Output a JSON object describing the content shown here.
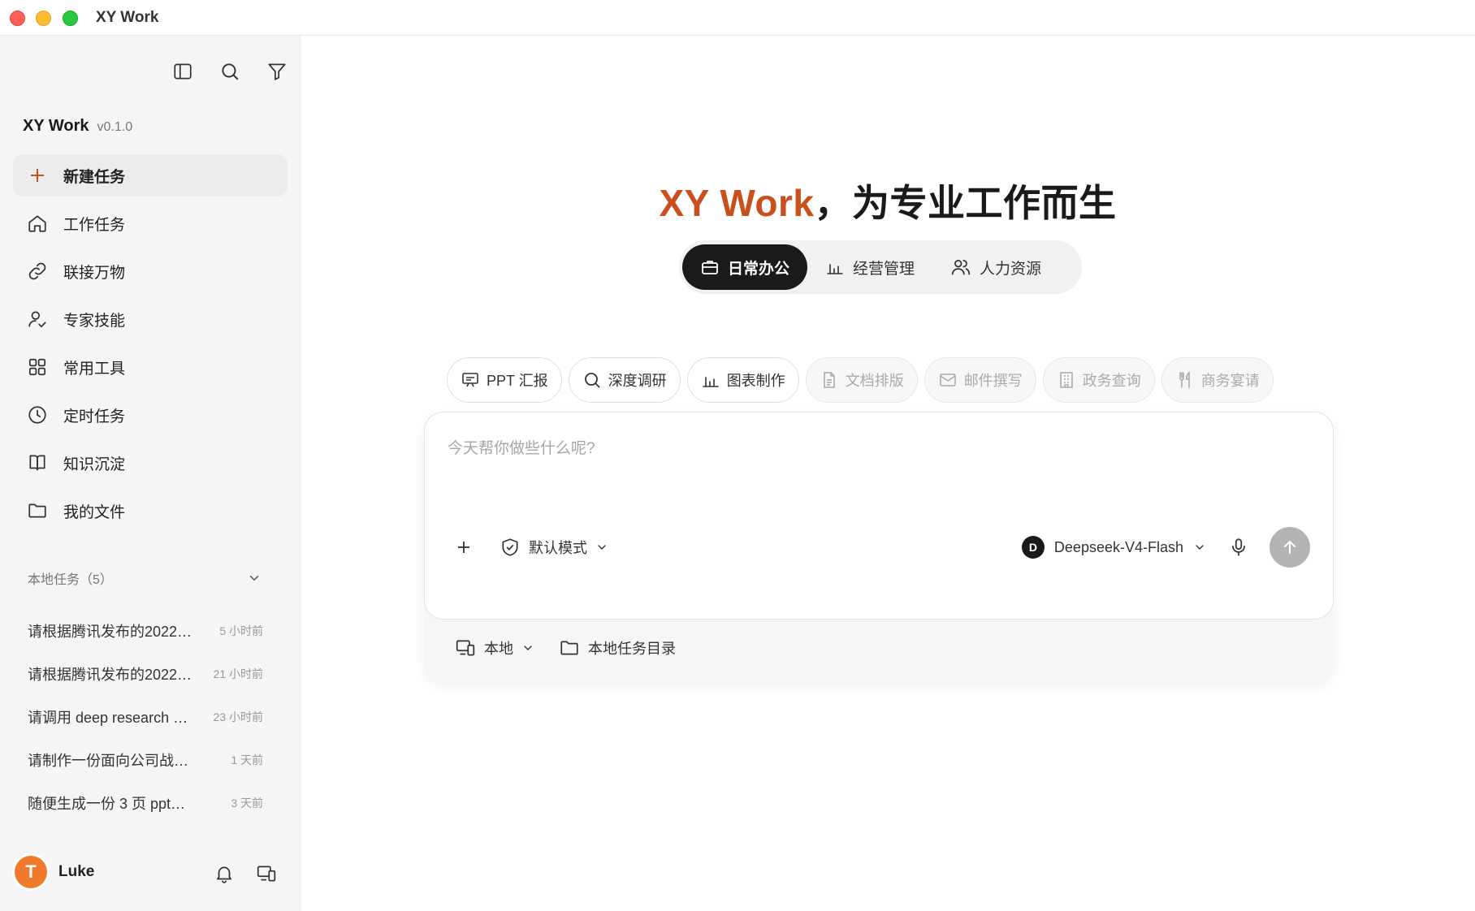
{
  "window": {
    "title": "XY Work"
  },
  "sidebar": {
    "brand": {
      "name": "XY Work",
      "version": "v0.1.0"
    },
    "nav": [
      {
        "label": "新建任务",
        "icon": "plus-icon"
      },
      {
        "label": "工作任务",
        "icon": "home-icon"
      },
      {
        "label": "联接万物",
        "icon": "link-icon"
      },
      {
        "label": "专家技能",
        "icon": "user-check-icon"
      },
      {
        "label": "常用工具",
        "icon": "grid-icon"
      },
      {
        "label": "定时任务",
        "icon": "clock-icon"
      },
      {
        "label": "知识沉淀",
        "icon": "book-icon"
      },
      {
        "label": "我的文件",
        "icon": "folder-icon"
      }
    ],
    "tasks_header": "本地任务（5）",
    "tasks": [
      {
        "title": "请根据腾讯发布的2022…",
        "time": "5 小时前"
      },
      {
        "title": "请根据腾讯发布的2022…",
        "time": "21 小时前"
      },
      {
        "title": "请调用 deep research …",
        "time": "23 小时前"
      },
      {
        "title": "请制作一份面向公司战略…",
        "time": "1 天前"
      },
      {
        "title": "随便生成一份 3 页 ppt，…",
        "time": "3 天前"
      }
    ],
    "user": {
      "initial": "T",
      "name": "Luke"
    }
  },
  "main": {
    "hero": {
      "accent": "XY Work",
      "rest": "，为专业工作而生"
    },
    "categories": [
      {
        "label": "日常办公",
        "icon": "briefcase-icon"
      },
      {
        "label": "经营管理",
        "icon": "bar-chart-icon"
      },
      {
        "label": "人力资源",
        "icon": "users-icon"
      }
    ],
    "chips": [
      {
        "label": "PPT 汇报",
        "icon": "presentation-icon"
      },
      {
        "label": "深度调研",
        "icon": "search-icon"
      },
      {
        "label": "图表制作",
        "icon": "bar-chart-icon"
      },
      {
        "label": "文档排版",
        "icon": "document-icon"
      },
      {
        "label": "邮件撰写",
        "icon": "mail-icon"
      },
      {
        "label": "政务查询",
        "icon": "building-icon"
      },
      {
        "label": "商务宴请",
        "icon": "utensils-icon"
      }
    ],
    "composer": {
      "placeholder": "今天帮你做些什么呢?",
      "mode": "默认模式",
      "model_badge": "D",
      "model": "Deepseek-V4-Flash"
    },
    "env": {
      "location": "本地",
      "directory": "本地任务目录"
    }
  },
  "colors": {
    "accent": "#c9501c",
    "avatar": "#f07a2b",
    "active_tab": "#1a1a1a"
  }
}
